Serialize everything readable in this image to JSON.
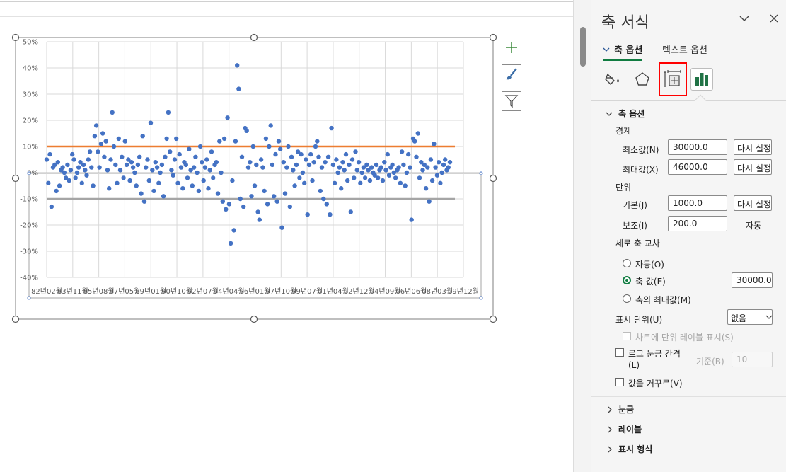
{
  "pane": {
    "title": "축 서식",
    "tabs": {
      "axis_options": "축 옵션",
      "text_options": "텍스트 옵션"
    },
    "axis_section": "축 옵션",
    "bounds": {
      "label": "경계",
      "min_label": "최소값(N)",
      "min_value": "30000.0",
      "max_label": "최대값(X)",
      "max_value": "46000.0",
      "reset": "다시 설정"
    },
    "units": {
      "label": "단위",
      "major_label": "기본(J)",
      "major_value": "1000.0",
      "minor_label": "보조(I)",
      "minor_value": "200.0",
      "auto": "자동",
      "reset": "다시 설정"
    },
    "crosses": {
      "label": "세로 축 교차",
      "auto": "자동(O)",
      "axis_value": "축 값(E)",
      "axis_value_input": "30000.0",
      "max": "축의 최대값(M)"
    },
    "display_units": {
      "label": "표시 단위(U)",
      "value": "없음",
      "show_label": "차트에 단위 레이블 표시(S)"
    },
    "log": {
      "label1": "로그 눈금 간격",
      "label2": "(L)",
      "base_label": "기준(B)",
      "base_value": "10"
    },
    "reverse": "값을 거꾸로(V)",
    "collapsed": [
      "눈금",
      "레이블",
      "표시 형식"
    ]
  },
  "chart_data": {
    "type": "scatter",
    "y_ticks": [
      "50%",
      "40%",
      "30%",
      "20%",
      "10%",
      "0%",
      "-10%",
      "-20%",
      "-30%",
      "-40%"
    ],
    "ylim": [
      -0.4,
      0.5
    ],
    "x_tick_labels": [
      "82년02월",
      "83년11월",
      "85년08월",
      "87년05월",
      "89년01월",
      "90년10월",
      "92년07월",
      "94년04월",
      "96년01월",
      "97년10월",
      "99년07월",
      "01년04월",
      "02년12월",
      "04년09월",
      "06년06월",
      "08년03월",
      "09년12월"
    ],
    "reference_lines": [
      {
        "value": 0.1,
        "color": "#ed7d31"
      },
      {
        "value": -0.1,
        "color": "#a5a5a5"
      }
    ],
    "series_color": "#4472c4",
    "series": [
      {
        "values": [
          0.05,
          -0.04,
          0.07,
          -0.13,
          0.02,
          0.03,
          -0.07,
          0.04,
          -0.05,
          0.01,
          0.02,
          0.0,
          -0.02,
          0.03,
          -0.03,
          0.01,
          0.07,
          0.05,
          -0.02,
          0.0,
          0.02,
          0.04,
          -0.04,
          0.03,
          0.01,
          -0.01,
          0.05,
          0.08,
          0.02,
          -0.05,
          0.14,
          0.18,
          0.08,
          0.02,
          0.11,
          0.15,
          0.06,
          0.12,
          0.01,
          -0.06,
          0.05,
          0.23,
          0.1,
          0.03,
          -0.04,
          0.13,
          0.01,
          0.06,
          -0.02,
          0.12,
          0.03,
          0.05,
          -0.03,
          0.04,
          0.02,
          0.0,
          -0.05,
          0.03,
          0.06,
          -0.08,
          0.14,
          -0.11,
          0.02,
          0.05,
          -0.03,
          0.19,
          0.01,
          -0.07,
          0.04,
          0.02,
          -0.04,
          0.0,
          0.03,
          -0.09,
          0.06,
          0.13,
          0.23,
          0.08,
          0.01,
          -0.01,
          0.05,
          0.13,
          -0.04,
          0.07,
          0.02,
          -0.06,
          0.04,
          0.03,
          -0.02,
          0.09,
          0.01,
          -0.05,
          0.02,
          0.06,
          0.0,
          -0.07,
          0.1,
          0.04,
          -0.03,
          0.02,
          0.05,
          -0.06,
          0.01,
          0.08,
          -0.02,
          0.03,
          0.04,
          -0.08,
          0.12,
          0.0,
          -0.11,
          0.13,
          -0.14,
          0.21,
          -0.12,
          -0.27,
          -0.03,
          -0.22,
          0.12,
          0.41,
          0.32,
          -0.1,
          0.06,
          -0.13,
          0.17,
          0.16,
          0.02,
          0.04,
          -0.09,
          0.1,
          -0.05,
          0.03,
          -0.15,
          -0.18,
          0.05,
          0.02,
          -0.07,
          0.13,
          -0.12,
          0.1,
          0.18,
          0.03,
          -0.09,
          0.07,
          -0.11,
          0.12,
          0.09,
          -0.21,
          0.04,
          -0.08,
          0.02,
          0.1,
          -0.13,
          0.06,
          0.01,
          -0.05,
          0.03,
          0.08,
          -0.02,
          0.07,
          0.0,
          -0.04,
          0.05,
          -0.16,
          0.03,
          0.07,
          -0.03,
          0.04,
          0.1,
          0.12,
          0.06,
          -0.07,
          0.02,
          -0.1,
          0.04,
          -0.12,
          0.06,
          -0.16,
          0.17,
          0.03,
          -0.04,
          0.05,
          0.0,
          0.02,
          -0.06,
          0.04,
          0.01,
          0.07,
          -0.03,
          0.03,
          -0.15,
          0.05,
          -0.02,
          0.08,
          0.01,
          0.04,
          -0.04,
          0.0,
          0.02,
          -0.02,
          0.03,
          0.01,
          -0.03,
          0.02,
          0.0,
          -0.01,
          0.03,
          -0.02,
          0.01,
          0.02,
          -0.03,
          0.04,
          0.01,
          0.07,
          -0.01,
          0.02,
          0.03,
          0.0,
          -0.02,
          0.01,
          0.02,
          -0.04,
          0.08,
          0.03,
          -0.05,
          0.0,
          0.07,
          0.02,
          -0.18,
          0.13,
          0.12,
          0.06,
          0.15,
          -0.02,
          0.04,
          0.01,
          0.03,
          -0.06,
          0.02,
          -0.11,
          0.05,
          -0.03,
          0.11,
          0.02,
          -0.01,
          0.04,
          -0.04,
          0.0,
          0.03,
          0.05,
          0.01,
          0.02,
          0.04
        ]
      }
    ]
  }
}
